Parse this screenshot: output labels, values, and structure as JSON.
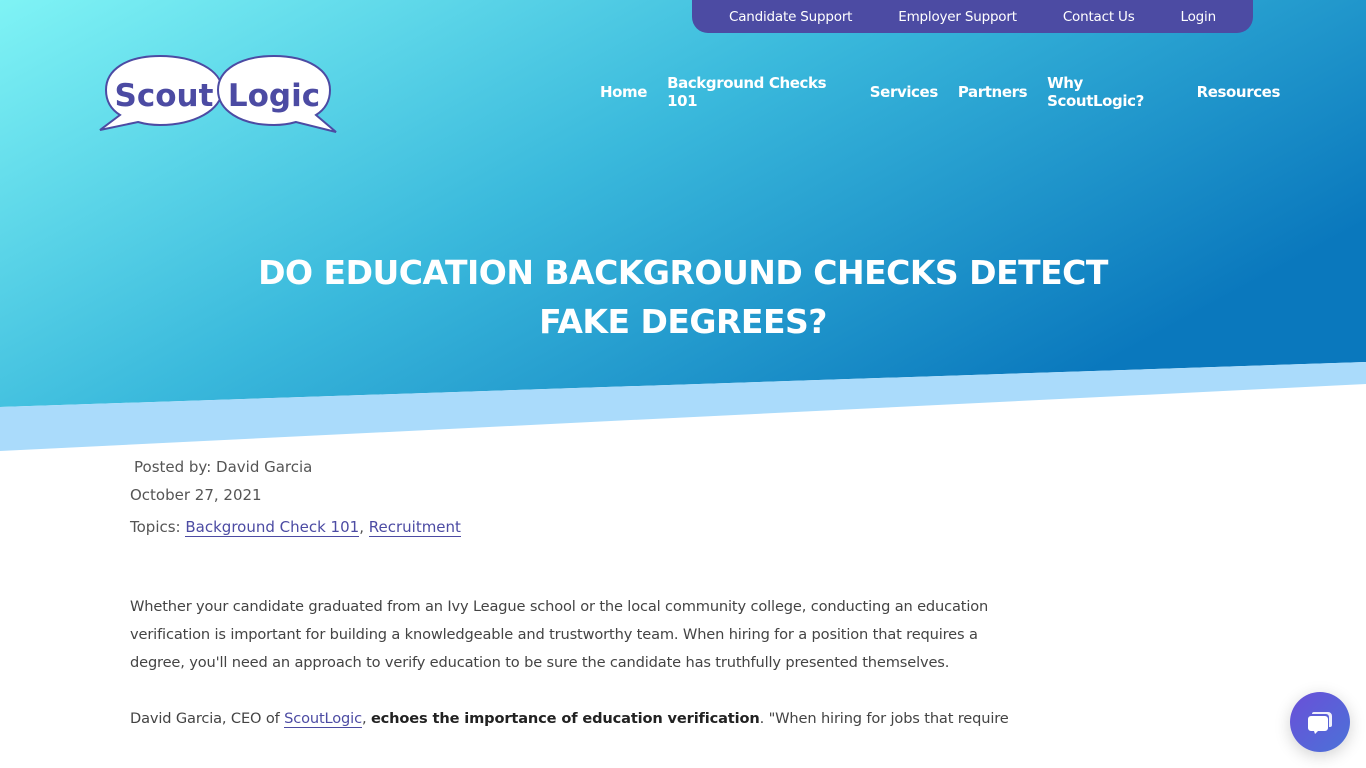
{
  "utility_nav": {
    "items": [
      {
        "label": "Candidate Support"
      },
      {
        "label": "Employer Support"
      },
      {
        "label": "Contact Us"
      },
      {
        "label": "Login"
      }
    ]
  },
  "brand": {
    "logo_left": "Scout",
    "logo_right": "Logic",
    "logo_color": "#4c4ba3"
  },
  "main_nav": {
    "items": [
      {
        "label": "Home"
      },
      {
        "label": "Background Checks 101"
      },
      {
        "label": "Services"
      },
      {
        "label": "Partners"
      },
      {
        "label": "Why ScoutLogic?"
      },
      {
        "label": "Resources"
      }
    ]
  },
  "hero": {
    "title": "DO EDUCATION BACKGROUND CHECKS DETECT FAKE DEGREES?",
    "gradient_start": "#7ff3f5",
    "gradient_end": "#0c7cbf",
    "band_color": "#aadbfb"
  },
  "post_meta": {
    "posted_by": "Posted by: David Garcia",
    "date": "October 27, 2021",
    "topics_label": "Topics:",
    "topics": [
      "Background Check 101",
      "Recruitment"
    ],
    "separator": ","
  },
  "article": {
    "paragraph1": "Whether your candidate graduated from an Ivy League school or the local community college, conducting an education verification is important for building a knowledgeable and trustworthy team. When hiring for a position that requires a degree, you'll need an approach to verify education to be sure the candidate has truthfully presented themselves.",
    "paragraph2_prefix": "David Garcia, CEO of ",
    "paragraph2_link": "ScoutLogic",
    "paragraph2_comma": ", ",
    "paragraph2_bold": "echoes the importance of education verification",
    "paragraph2_suffix": ". \"When hiring for jobs that require"
  },
  "chat": {
    "icon": "chat-bubbles-icon"
  }
}
